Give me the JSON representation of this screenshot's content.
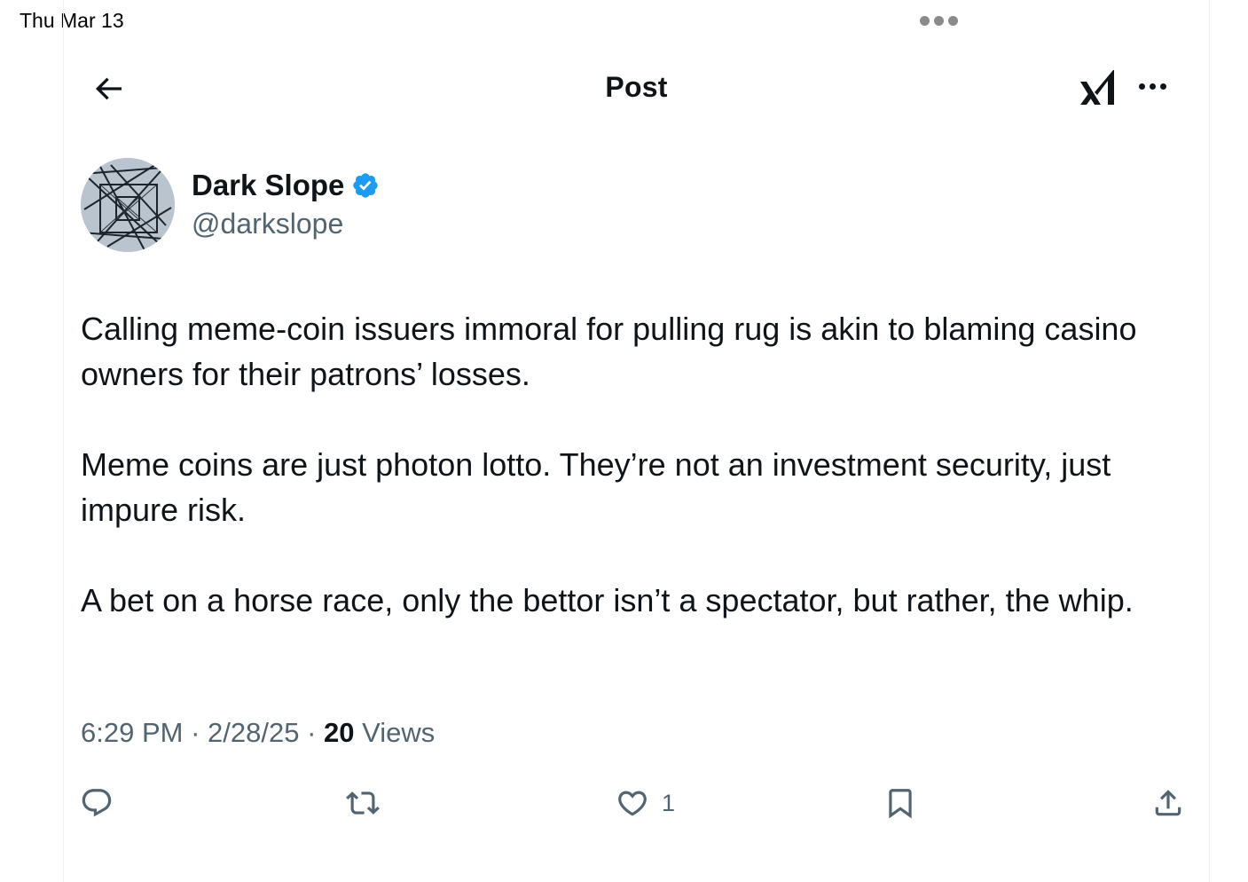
{
  "status_bar": {
    "date": "Thu Mar 13"
  },
  "header": {
    "title": "Post"
  },
  "author": {
    "display_name": "Dark Slope",
    "handle": "@darkslope",
    "verified": true
  },
  "tweet": {
    "paragraphs": [
      "Calling meme-coin issuers immoral for pulling rug is akin to blaming casino owners for their patrons’ losses.",
      "Meme coins are just photon lotto. They’re not an investment security, just impure risk.",
      "A bet on a horse race, only the bettor isn’t a spectator, but rather, the whip."
    ]
  },
  "meta": {
    "time": "6:29 PM",
    "date": "2/28/25",
    "views_count": "20",
    "views_label": "Views",
    "separator": "·"
  },
  "actions": {
    "like_count": "1"
  },
  "colors": {
    "verified": "#1d9bf0",
    "secondary_text": "#536471",
    "primary_text": "#0f1419"
  }
}
